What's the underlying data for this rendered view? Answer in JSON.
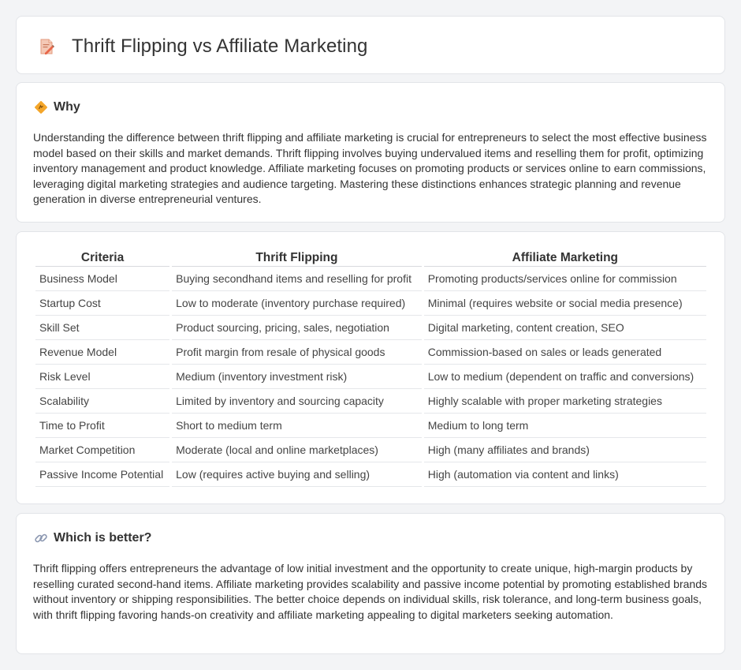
{
  "header": {
    "title": "Thrift Flipping vs Affiliate Marketing",
    "icon": "document-pencil-icon"
  },
  "why": {
    "title": "Why",
    "icon": "diamond-sign-icon",
    "text": "Understanding the difference between thrift flipping and affiliate marketing is crucial for entrepreneurs to select the most effective business model based on their skills and market demands. Thrift flipping involves buying undervalued items and reselling them for profit, optimizing inventory management and product knowledge. Affiliate marketing focuses on promoting products or services online to earn commissions, leveraging digital marketing strategies and audience targeting. Mastering these distinctions enhances strategic planning and revenue generation in diverse entrepreneurial ventures."
  },
  "table": {
    "headers": [
      "Criteria",
      "Thrift Flipping",
      "Affiliate Marketing"
    ],
    "rows": [
      [
        "Business Model",
        "Buying secondhand items and reselling for profit",
        "Promoting products/services online for commission"
      ],
      [
        "Startup Cost",
        "Low to moderate (inventory purchase required)",
        "Minimal (requires website or social media presence)"
      ],
      [
        "Skill Set",
        "Product sourcing, pricing, sales, negotiation",
        "Digital marketing, content creation, SEO"
      ],
      [
        "Revenue Model",
        "Profit margin from resale of physical goods",
        "Commission-based on sales or leads generated"
      ],
      [
        "Risk Level",
        "Medium (inventory investment risk)",
        "Low to medium (dependent on traffic and conversions)"
      ],
      [
        "Scalability",
        "Limited by inventory and sourcing capacity",
        "Highly scalable with proper marketing strategies"
      ],
      [
        "Time to Profit",
        "Short to medium term",
        "Medium to long term"
      ],
      [
        "Market Competition",
        "Moderate (local and online marketplaces)",
        "High (many affiliates and brands)"
      ],
      [
        "Passive Income Potential",
        "Low (requires active buying and selling)",
        "High (automation via content and links)"
      ]
    ]
  },
  "better": {
    "title": "Which is better?",
    "icon": "link-icon",
    "text": "Thrift flipping offers entrepreneurs the advantage of low initial investment and the opportunity to create unique, high-margin products by reselling curated second-hand items. Affiliate marketing provides scalability and passive income potential by promoting established brands without inventory or shipping responsibilities. The better choice depends on individual skills, risk tolerance, and long-term business goals, with thrift flipping favoring hands-on creativity and affiliate marketing appealing to digital marketers seeking automation."
  }
}
